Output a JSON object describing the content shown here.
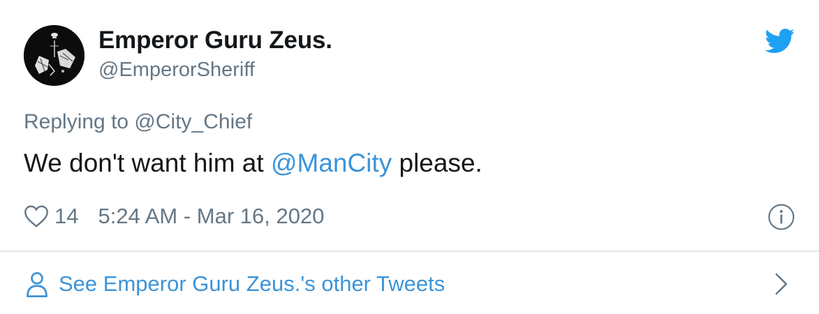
{
  "author": {
    "display_name": "Emperor Guru Zeus.",
    "handle": "@EmperorSheriff",
    "avatar_icon": "profile-avatar"
  },
  "brand": {
    "icon": "twitter-bird-icon",
    "color": "#1da1f2"
  },
  "tweet": {
    "reply_to": "Replying to @City_Chief",
    "text_before": "We don't want him at ",
    "mention": "@ManCity",
    "text_after": " please.",
    "likes": "14",
    "timestamp": "5:24 AM - Mar 16, 2020"
  },
  "footer": {
    "link_label": "See Emperor Guru Zeus.'s other Tweets"
  },
  "colors": {
    "text": "#14171a",
    "secondary": "#657786",
    "link": "#3b94d9",
    "divider": "#e1e8ed"
  }
}
